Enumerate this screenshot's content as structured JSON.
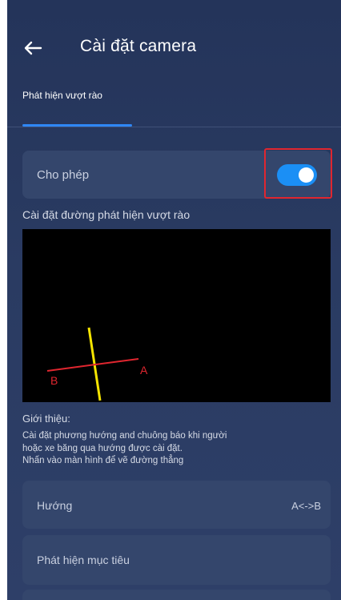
{
  "header": {
    "title": "Cài đặt camera"
  },
  "tabs": [
    {
      "label": "Phát hiện vượt rào",
      "active": true
    }
  ],
  "allow": {
    "label": "Cho phép",
    "enabled": true
  },
  "line_setting": {
    "label": "Cài đặt đường phát hiện vượt rào",
    "point_a": "A",
    "point_b": "B"
  },
  "intro": {
    "title": "Giới thiệu:",
    "lines": [
      "Cài đặt phương hướng and chuông báo khi người",
      "hoặc xe băng qua hướng được cài đặt.",
      "Nhấn vào màn hình để vẽ đường thẳng"
    ]
  },
  "settings": [
    {
      "label": "Hướng",
      "value": "A<->B"
    },
    {
      "label": "Phát hiện mục tiêu"
    }
  ],
  "colors": {
    "accent": "#1b8ff5",
    "highlight": "#e0262f",
    "line_yellow": "#f5e400",
    "line_red": "#e0262f",
    "background": "#2a3b62"
  }
}
